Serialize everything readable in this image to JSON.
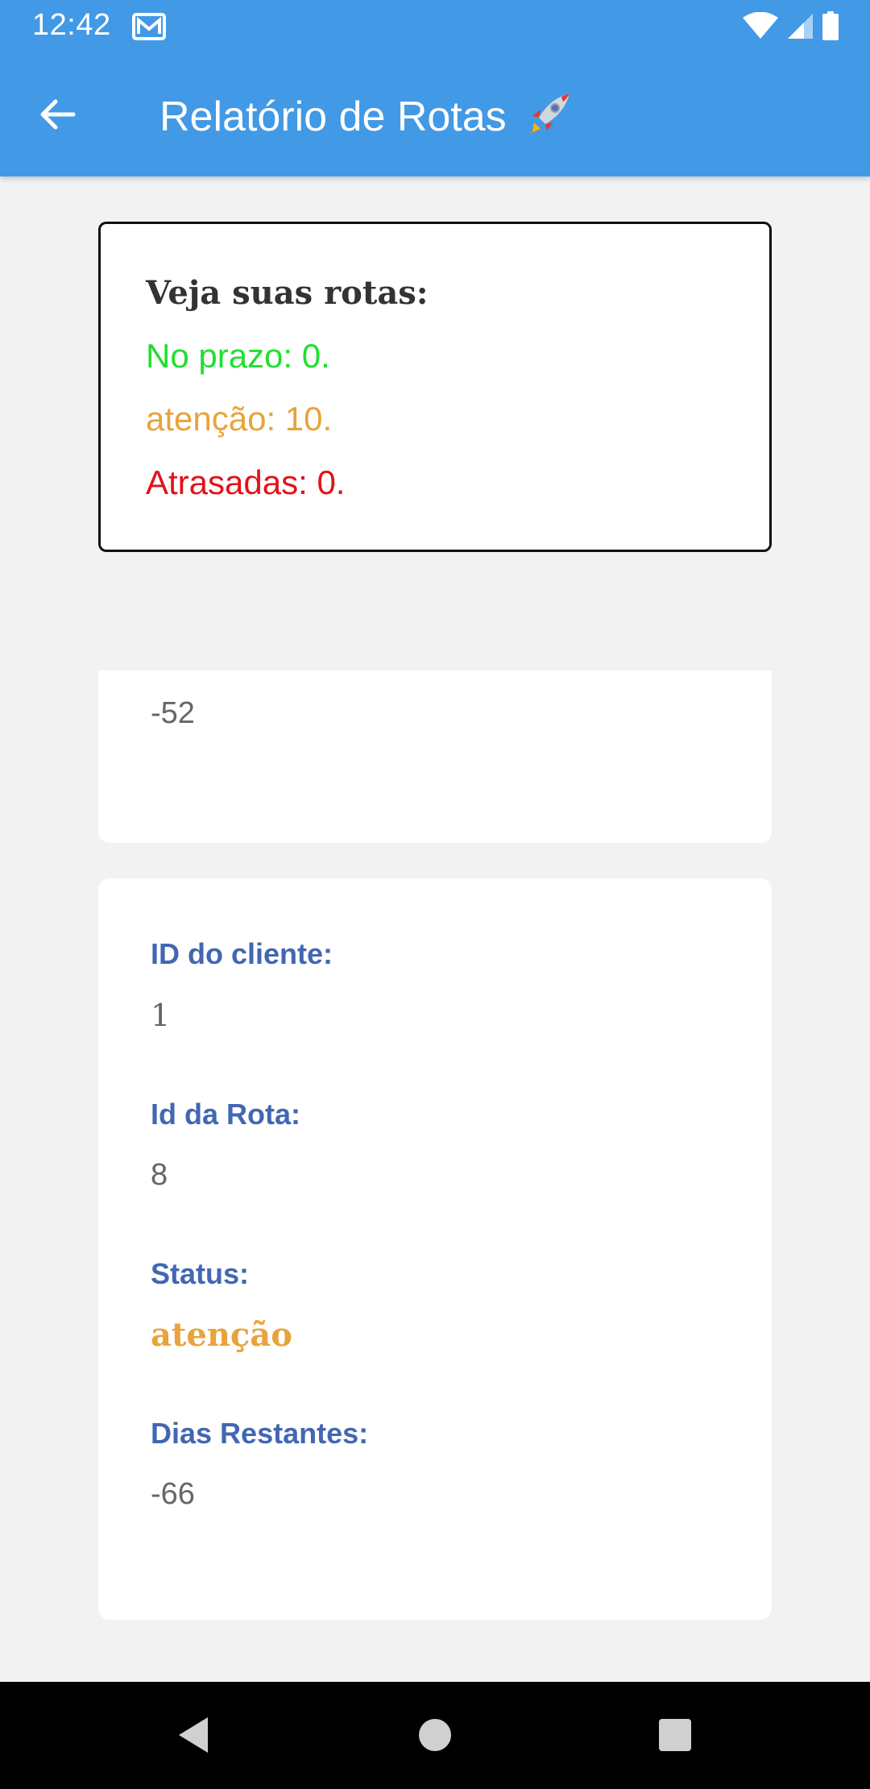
{
  "status_bar": {
    "time": "12:42",
    "icons": [
      "mail-icon",
      "wifi-icon",
      "signal-icon",
      "battery-icon"
    ]
  },
  "app_bar": {
    "back_icon": "arrow-left-icon",
    "title": "Relatório de Rotas",
    "title_emoji": "rocket-icon"
  },
  "summary": {
    "title": "Veja suas rotas:",
    "on_time": "No prazo: 0.",
    "attention": "atenção: 10.",
    "late": "Atrasadas: 0."
  },
  "cards": [
    {
      "partial": true,
      "dias_restantes_value": "-52"
    },
    {
      "client_id_label": "ID do cliente:",
      "client_id_value": "1",
      "route_id_label": "Id da Rota:",
      "route_id_value": "8",
      "status_label": "Status:",
      "status_value": "atenção",
      "days_label": "Dias Restantes:",
      "days_value": "-66"
    }
  ],
  "colors": {
    "app_bar": "#4299e6",
    "on_time": "#1ee02e",
    "attention": "#e8a33c",
    "late": "#e31217",
    "label": "#4267b2"
  },
  "nav_bar": {
    "buttons": [
      "back-triangle-icon",
      "home-circle-icon",
      "recents-square-icon"
    ]
  }
}
